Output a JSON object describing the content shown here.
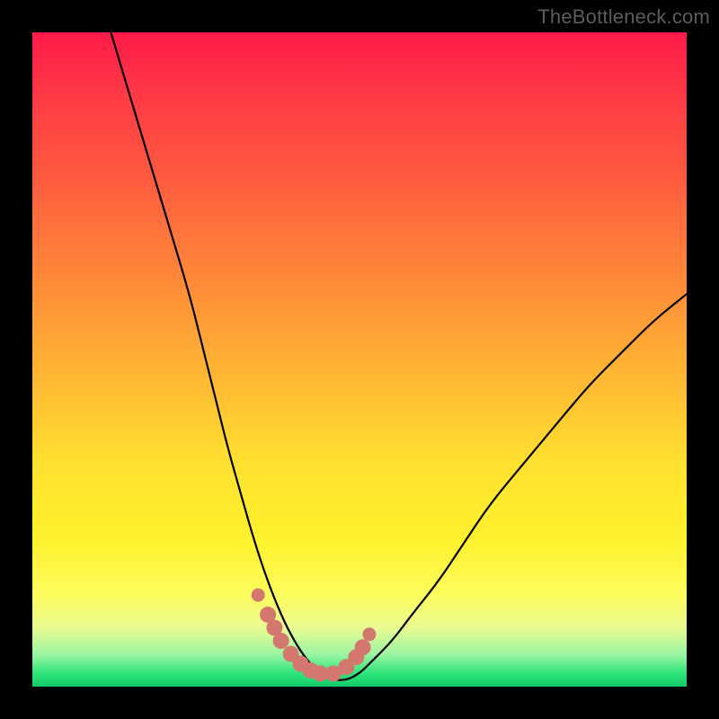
{
  "watermark": "TheBottleneck.com",
  "colors": {
    "background": "#000000",
    "gradient_top": "#ff1a49",
    "gradient_mid1": "#ff8a38",
    "gradient_mid2": "#ffe12f",
    "gradient_bottom": "#14c96a",
    "curve": "#000000",
    "markers": "#d4786f"
  },
  "chart_data": {
    "type": "line",
    "title": "",
    "xlabel": "",
    "ylabel": "",
    "xlim": [
      0,
      100
    ],
    "ylim": [
      0,
      100
    ],
    "grid": false,
    "legend": false,
    "description": "V-shaped bottleneck curve where y≈100 at left edge, descends to ≈0 near x≈40, stays near 0 to x≈48, then rises toward y≈60 at right edge. Background color encodes y (red=high bottleneck at top, green=low at bottom).",
    "series": [
      {
        "name": "curve",
        "x": [
          12,
          15,
          18,
          21,
          24,
          26,
          28,
          30,
          32,
          34,
          36,
          38,
          40,
          42,
          44,
          46,
          48,
          50,
          52,
          55,
          58,
          62,
          66,
          70,
          75,
          80,
          85,
          90,
          95,
          100
        ],
        "y": [
          100,
          90,
          80,
          70,
          60,
          52,
          44,
          36,
          29,
          22,
          16,
          11,
          7,
          4,
          2,
          1,
          1,
          2,
          4,
          7,
          11,
          16,
          22,
          28,
          34,
          40,
          46,
          51,
          56,
          60
        ]
      }
    ],
    "markers": {
      "name": "highlighted-points",
      "x": [
        34.5,
        36,
        37,
        38,
        39.5,
        41,
        42.5,
        44,
        46,
        48,
        49.5,
        50.5,
        51.5
      ],
      "y": [
        14,
        11,
        9,
        7,
        5,
        3.5,
        2.5,
        2,
        2,
        3,
        4.5,
        6,
        8
      ]
    }
  }
}
